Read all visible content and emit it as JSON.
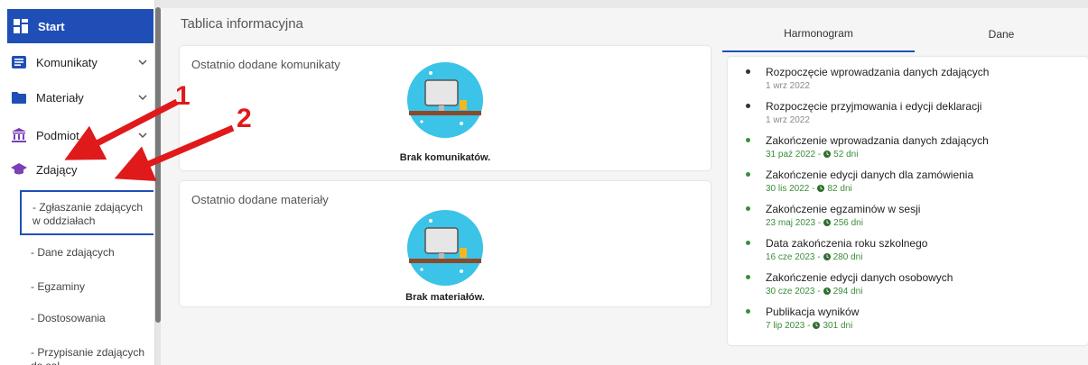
{
  "sidebar": {
    "start": "Start",
    "komunikaty": "Komunikaty",
    "materialy": "Materiały",
    "podmiot": "Podmiot",
    "zdajacy": "Zdający",
    "sub": {
      "zglaszanie": "- Zgłaszanie zdających w oddziałach",
      "dane": "- Dane zdających",
      "egzaminy": "- Egzaminy",
      "dostosowania": "- Dostosowania",
      "przypisanie": "- Przypisanie zdających do sal"
    }
  },
  "header": {
    "title": "Tablica informacyjna"
  },
  "cards": {
    "komunikaty": {
      "title": "Ostatnio dodane komunikaty",
      "empty": "Brak komunikatów."
    },
    "materialy": {
      "title": "Ostatnio dodane materiały",
      "empty": "Brak materiałów."
    }
  },
  "tabs": {
    "harmonogram": "Harmonogram",
    "dane": "Dane"
  },
  "timeline": [
    {
      "name": "Rozpoczęcie wprowadzania danych zdających",
      "date": "1 wrz 2022",
      "days": ""
    },
    {
      "name": "Rozpoczęcie przyjmowania i edycji deklaracji",
      "date": "1 wrz 2022",
      "days": ""
    },
    {
      "name": "Zakończenie wprowadzania danych zdających",
      "date": "31 paź 2022 -",
      "days": "52 dni"
    },
    {
      "name": "Zakończenie edycji danych dla zamówienia",
      "date": "30 lis 2022 -",
      "days": "82 dni"
    },
    {
      "name": "Zakończenie egzaminów w sesji",
      "date": "23 maj 2023 -",
      "days": "256 dni"
    },
    {
      "name": "Data zakończenia roku szkolnego",
      "date": "16 cze 2023 -",
      "days": "280 dni"
    },
    {
      "name": "Zakończenie edycji danych osobowych",
      "date": "30 cze 2023 -",
      "days": "294 dni"
    },
    {
      "name": "Publikacja wyników",
      "date": "7 lip 2023 -",
      "days": "301 dni"
    }
  ],
  "annotations": {
    "one": "1",
    "two": "2"
  },
  "colors": {
    "brand": "#1f4fb6",
    "future": "#3a8f3a",
    "past": "#8a8a8a",
    "arrow": "#e0191b",
    "illustration": "#3bc3e8"
  }
}
